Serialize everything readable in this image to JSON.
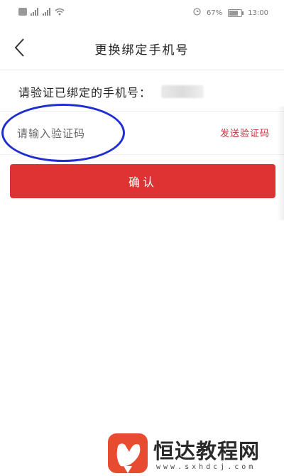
{
  "status_bar": {
    "time": "13:00",
    "battery_text": "67%"
  },
  "nav": {
    "title": "更换绑定手机号"
  },
  "form": {
    "phone_label": "请验证已绑定的手机号：",
    "code_placeholder": "请输入验证码",
    "send_code_label": "发送验证码",
    "confirm_label": "确认"
  },
  "watermark": {
    "name": "恒达教程网",
    "url": "www.sxhdcj.com"
  },
  "colors": {
    "accent": "#dd3333",
    "send_code": "#c0333c",
    "annotation_circle": "#1e2ed0"
  }
}
